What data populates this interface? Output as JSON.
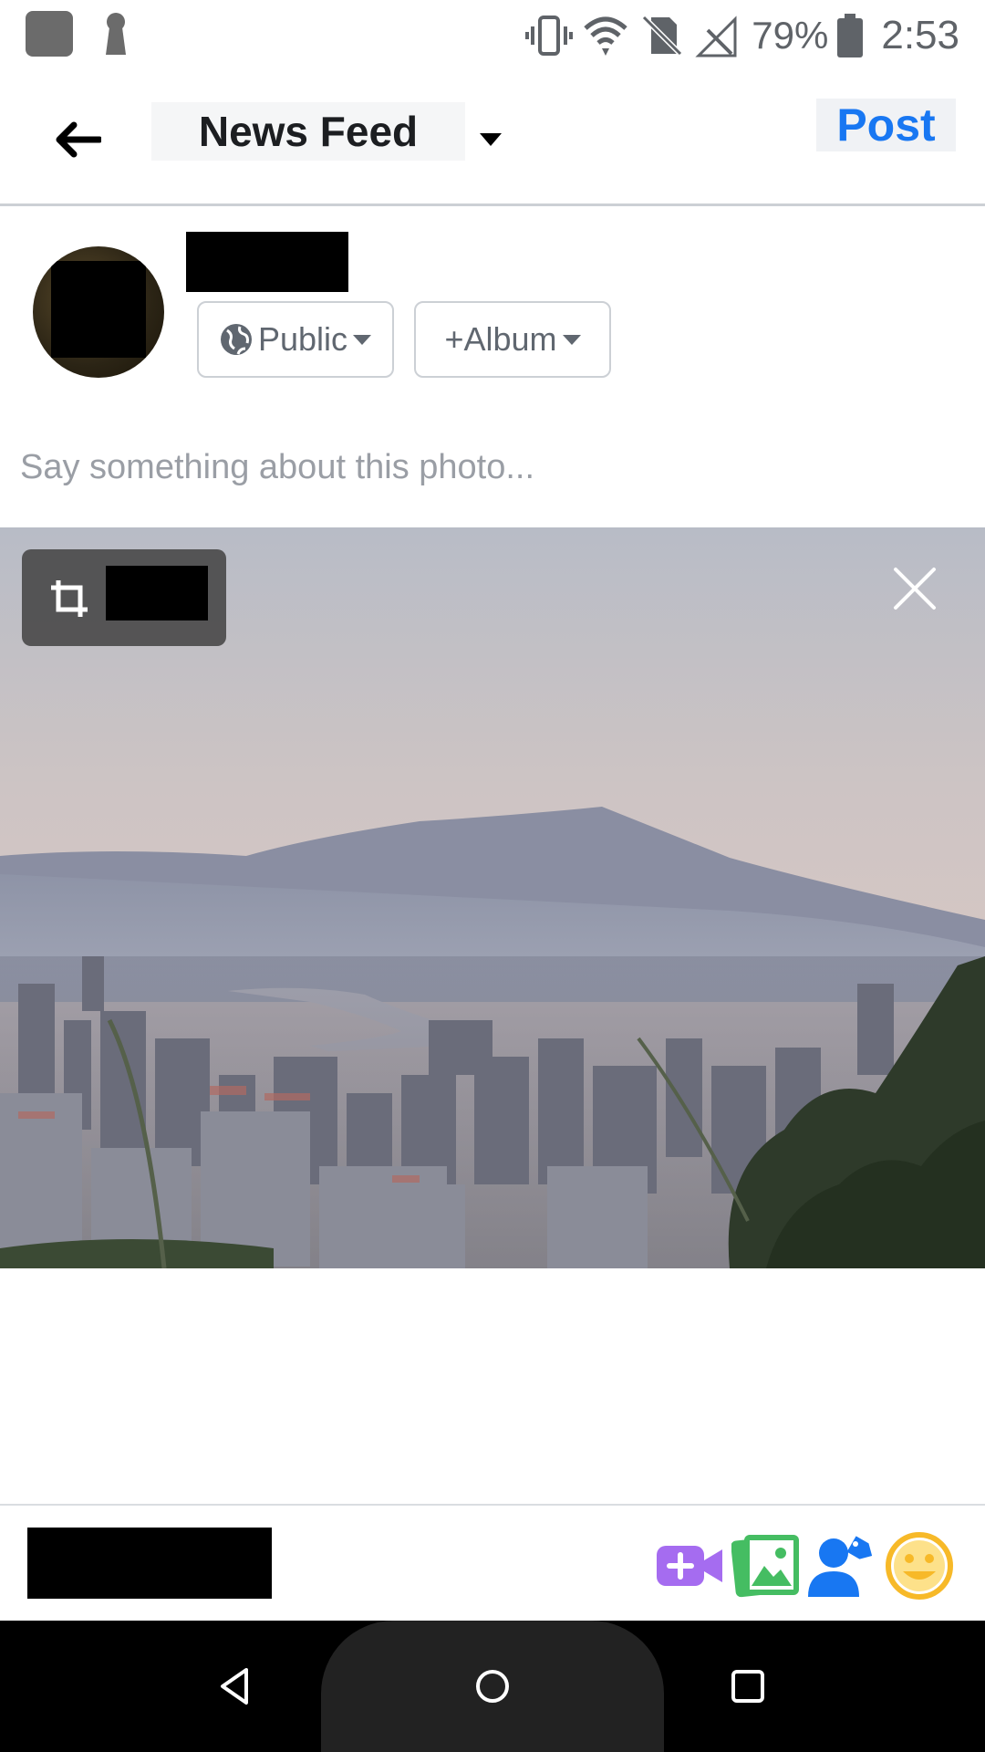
{
  "status_bar": {
    "battery_percent": "79%",
    "time": "2:53",
    "icons": [
      "notification-square-icon",
      "keyhole-icon",
      "vibrate-icon",
      "wifi-icon",
      "no-sim-icon",
      "no-signal-icon",
      "battery-icon"
    ]
  },
  "header": {
    "back_icon": "arrow-left-icon",
    "title": "News Feed",
    "title_caret_icon": "caret-down-icon",
    "post_label": "Post"
  },
  "composer": {
    "privacy_label": "Public",
    "privacy_icon": "globe-icon",
    "album_label": "+Album",
    "text_placeholder": "Say something about this photo..."
  },
  "photo": {
    "crop_icon": "crop-icon",
    "close_icon": "close-icon"
  },
  "bottom_actions": [
    {
      "name": "video-icon",
      "color": "#a56cf0"
    },
    {
      "name": "photo-icon",
      "color": "#45bd62"
    },
    {
      "name": "tag-people-icon",
      "color": "#1877f2"
    },
    {
      "name": "feeling-icon",
      "color": "#f7b928"
    }
  ],
  "colors": {
    "accent": "#1877f2",
    "text_primary": "#1c1e21",
    "text_secondary": "#606770",
    "border": "#ccd0d5"
  }
}
